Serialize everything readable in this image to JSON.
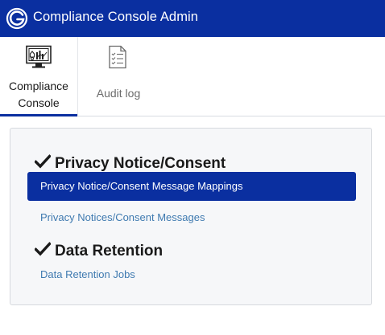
{
  "app": {
    "title": "Compliance Console Admin"
  },
  "nav": {
    "tabs": [
      {
        "label_line1": "Compliance",
        "label_line2": "Console",
        "icon": "dashboard-monitor-icon",
        "active": true
      },
      {
        "label": "Audit log",
        "icon": "checklist-document-icon",
        "active": false
      }
    ]
  },
  "sections": [
    {
      "heading": "Privacy Notice/Consent",
      "icon": "checkmark-icon",
      "links": [
        {
          "label": "Privacy Notice/Consent Message Mappings",
          "selected": true
        },
        {
          "label": "Privacy Notices/Consent Messages",
          "selected": false
        }
      ]
    },
    {
      "heading": "Data Retention",
      "icon": "checkmark-icon",
      "links": [
        {
          "label": "Data Retention Jobs",
          "selected": false
        }
      ]
    }
  ],
  "colors": {
    "brand": "#0a2fa0",
    "link": "#3f7ab0",
    "card_background": "#f6f7f9"
  }
}
